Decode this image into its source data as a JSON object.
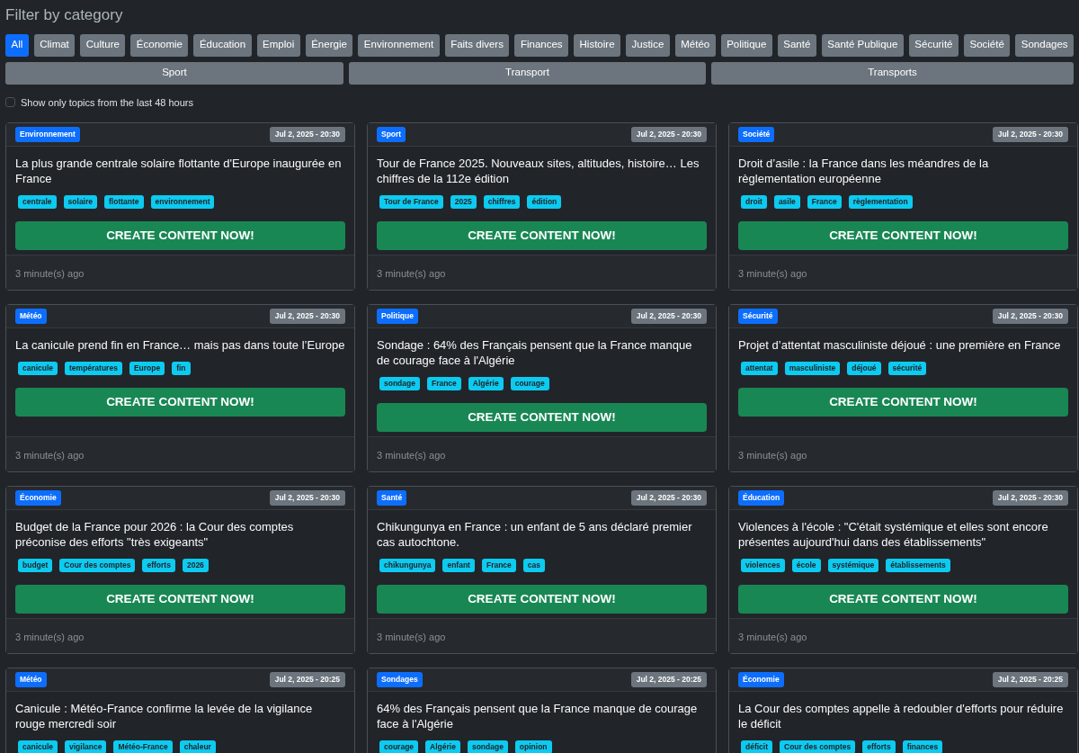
{
  "heading": "Filter by category",
  "category_rows": [
    [
      {
        "label": "All",
        "selected": true
      },
      {
        "label": "Climat",
        "selected": false
      },
      {
        "label": "Culture",
        "selected": false
      },
      {
        "label": "Économie",
        "selected": false
      },
      {
        "label": "Éducation",
        "selected": false
      },
      {
        "label": "Emploi",
        "selected": false
      },
      {
        "label": "Énergie",
        "selected": false
      },
      {
        "label": "Environnement",
        "selected": false
      },
      {
        "label": "Faits divers",
        "selected": false
      },
      {
        "label": "Finances",
        "selected": false
      },
      {
        "label": "Histoire",
        "selected": false
      },
      {
        "label": "Justice",
        "selected": false
      },
      {
        "label": "Météo",
        "selected": false
      },
      {
        "label": "Politique",
        "selected": false
      },
      {
        "label": "Santé",
        "selected": false
      },
      {
        "label": "Santé Publique",
        "selected": false
      },
      {
        "label": "Sécurité",
        "selected": false
      },
      {
        "label": "Société",
        "selected": false
      },
      {
        "label": "Sondages",
        "selected": false
      }
    ],
    [
      {
        "label": "Sport",
        "selected": false
      },
      {
        "label": "Transport",
        "selected": false
      },
      {
        "label": "Transports",
        "selected": false
      }
    ]
  ],
  "recent_filter": {
    "label": "Show only topics from the last 48 hours",
    "checked": false
  },
  "cards": [
    {
      "category": "Environnement",
      "date": "Jul 2, 2025 - 20:30",
      "title": "La plus grande centrale solaire flottante d'Europe inaugurée en France",
      "tags": [
        "centrale",
        "solaire",
        "flottante",
        "environnement"
      ],
      "button": "CREATE CONTENT NOW!",
      "age": "3 minute(s) ago"
    },
    {
      "category": "Sport",
      "date": "Jul 2, 2025 - 20:30",
      "title": "Tour de France 2025. Nouveaux sites, altitudes, histoire… Les chiffres de la 112e édition",
      "tags": [
        "Tour de France",
        "2025",
        "chiffres",
        "édition"
      ],
      "button": "CREATE CONTENT NOW!",
      "age": "3 minute(s) ago"
    },
    {
      "category": "Société",
      "date": "Jul 2, 2025 - 20:30",
      "title": "Droit d’asile : la France dans les méandres de la règlementation européenne",
      "tags": [
        "droit",
        "asile",
        "France",
        "règlementation"
      ],
      "button": "CREATE CONTENT NOW!",
      "age": "3 minute(s) ago"
    },
    {
      "category": "Météo",
      "date": "Jul 2, 2025 - 20:30",
      "title": "La canicule prend fin en France… mais pas dans toute l’Europe",
      "tags": [
        "canicule",
        "températures",
        "Europe",
        "fin"
      ],
      "button": "CREATE CONTENT NOW!",
      "age": "3 minute(s) ago"
    },
    {
      "category": "Politique",
      "date": "Jul 2, 2025 - 20:30",
      "title": "Sondage : 64% des Français pensent que la France manque de courage face à l'Algérie",
      "tags": [
        "sondage",
        "France",
        "Algérie",
        "courage"
      ],
      "button": "CREATE CONTENT NOW!",
      "age": "3 minute(s) ago"
    },
    {
      "category": "Sécurité",
      "date": "Jul 2, 2025 - 20:30",
      "title": "Projet d’attentat masculiniste déjoué : une première en France",
      "tags": [
        "attentat",
        "masculiniste",
        "déjoué",
        "sécurité"
      ],
      "button": "CREATE CONTENT NOW!",
      "age": "3 minute(s) ago"
    },
    {
      "category": "Économie",
      "date": "Jul 2, 2025 - 20:30",
      "title": "Budget de la France pour 2026 : la Cour des comptes préconise des efforts \"très exigeants\"",
      "tags": [
        "budget",
        "Cour des comptes",
        "efforts",
        "2026"
      ],
      "button": "CREATE CONTENT NOW!",
      "age": "3 minute(s) ago"
    },
    {
      "category": "Santé",
      "date": "Jul 2, 2025 - 20:30",
      "title": "Chikungunya en France : un enfant de 5 ans déclaré premier cas autochtone.",
      "tags": [
        "chikungunya",
        "enfant",
        "France",
        "cas"
      ],
      "button": "CREATE CONTENT NOW!",
      "age": "3 minute(s) ago"
    },
    {
      "category": "Éducation",
      "date": "Jul 2, 2025 - 20:30",
      "title": "Violences à l'école : \"C'était systémique et elles sont encore présentes aujourd'hui dans des établissements\"",
      "tags": [
        "violences",
        "école",
        "systémique",
        "établissements"
      ],
      "button": "CREATE CONTENT NOW!",
      "age": "3 minute(s) ago"
    },
    {
      "category": "Météo",
      "date": "Jul 2, 2025 - 20:25",
      "title": "Canicule : Météo-France confirme la levée de la vigilance rouge mercredi soir",
      "tags": [
        "canicule",
        "vigilance",
        "Météo-France",
        "chaleur"
      ]
    },
    {
      "category": "Sondages",
      "date": "Jul 2, 2025 - 20:25",
      "title": "64% des Français pensent que la France manque de courage face à l'Algérie",
      "tags": [
        "courage",
        "Algérie",
        "sondage",
        "opinion"
      ]
    },
    {
      "category": "Économie",
      "date": "Jul 2, 2025 - 20:25",
      "title": "La Cour des comptes appelle à redoubler d'efforts pour réduire le déficit",
      "tags": [
        "déficit",
        "Cour des comptes",
        "efforts",
        "finances"
      ]
    }
  ]
}
